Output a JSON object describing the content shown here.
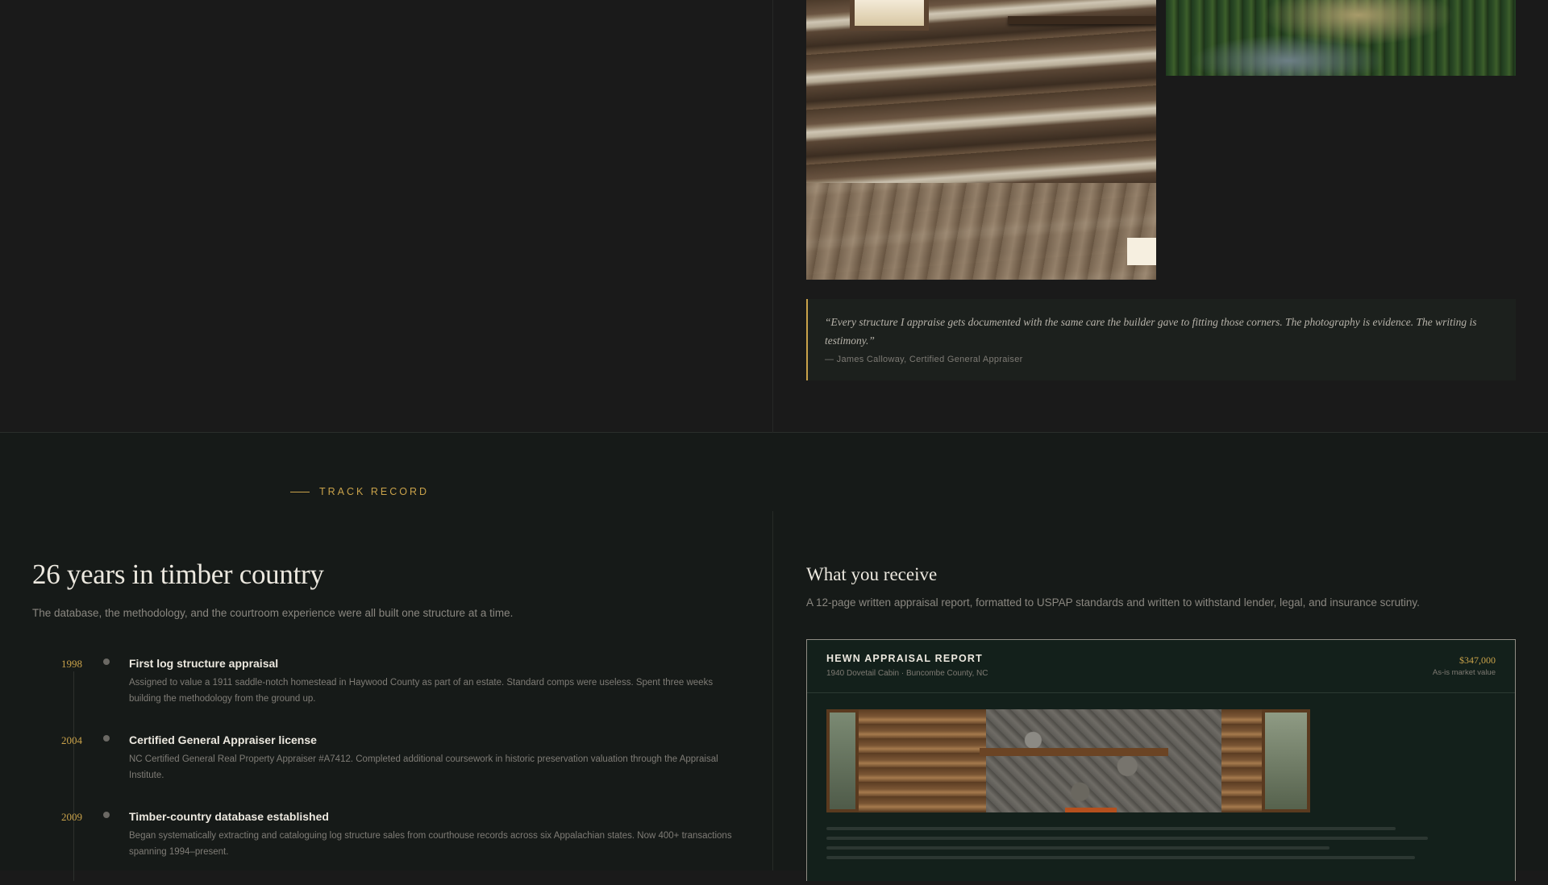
{
  "quote": {
    "text": "“Every structure I appraise gets documented with the same care the builder gave to fitting those corners. The photography is evidence. The writing is testimony.”",
    "attribution": "— James Calloway, Certified General Appraiser"
  },
  "track_record": {
    "eyebrow": "TRACK RECORD",
    "title": "26 years in timber country",
    "subtitle": "The database, the methodology, and the courtroom experience were all built one structure at a time.",
    "timeline": [
      {
        "year": "1998",
        "title": "First log structure appraisal",
        "description": "Assigned to value a 1911 saddle-notch homestead in Haywood County as part of an estate. Standard comps were useless. Spent three weeks building the methodology from the ground up."
      },
      {
        "year": "2004",
        "title": "Certified General Appraiser license",
        "description": "NC Certified General Real Property Appraiser #A7412. Completed additional coursework in historic preservation valuation through the Appraisal Institute."
      },
      {
        "year": "2009",
        "title": "Timber-country database established",
        "description": "Began systematically extracting and cataloguing log structure sales from courthouse records across six Appalachian states. Now 400+ transactions spanning 1994–present."
      }
    ]
  },
  "receive": {
    "title": "What you receive",
    "subtitle": "A 12-page written appraisal report, formatted to USPAP standards and written to withstand lender, legal, and insurance scrutiny.",
    "report": {
      "name": "HEWN APPRAISAL REPORT",
      "location": "1940 Dovetail Cabin · Buncombe County, NC",
      "value": "$347,000",
      "value_label": "As-is market value"
    }
  },
  "colors": {
    "accent_gold": "#c9a24a",
    "background_dark": "#1a1a1a",
    "section_dark": "#161a18",
    "card_green": "#13201b"
  }
}
